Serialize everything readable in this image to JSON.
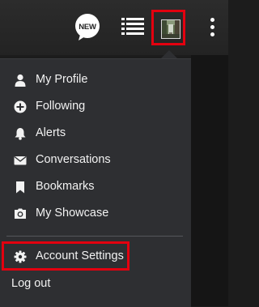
{
  "header": {
    "new_badge_label": "NEW",
    "icons": [
      "new-badge-icon",
      "list-icon",
      "user-avatar",
      "more-vertical-icon"
    ]
  },
  "menu": {
    "items": [
      {
        "label": "My Profile",
        "icon": "user-icon"
      },
      {
        "label": "Following",
        "icon": "plus-circle-icon"
      },
      {
        "label": "Alerts",
        "icon": "bell-icon"
      },
      {
        "label": "Conversations",
        "icon": "envelope-icon"
      },
      {
        "label": "Bookmarks",
        "icon": "bookmark-icon"
      },
      {
        "label": "My Showcase",
        "icon": "camera-icon"
      }
    ],
    "settings_label": "Account Settings",
    "logout_label": "Log out"
  },
  "colors": {
    "highlight": "#e3000f",
    "menu_bg": "#2e2f32",
    "text": "#f2f2f2"
  }
}
